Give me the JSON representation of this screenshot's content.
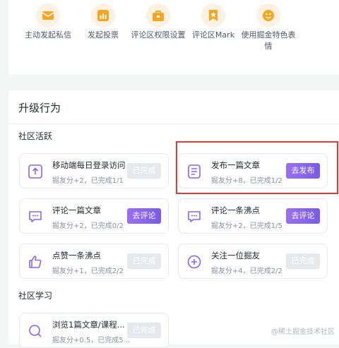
{
  "perks": [
    {
      "label": "主动发起私信",
      "icon": "mail-icon"
    },
    {
      "label": "发起投票",
      "icon": "chart-icon"
    },
    {
      "label": "评论区权限设置",
      "icon": "lock-icon"
    },
    {
      "label": "评论区Mark",
      "icon": "bookmark-star-icon"
    },
    {
      "label": "使用掘金特色表情",
      "icon": "smile-icon"
    }
  ],
  "section_title": "升级行为",
  "groups": [
    {
      "heading": "社区活跃"
    },
    {
      "heading": "社区学习"
    }
  ],
  "tasks": [
    {
      "name": "移动端每日登录访问",
      "desc": "掘友分+2，已完成1/1",
      "button": "已完成",
      "state": "done",
      "icon": "login-icon"
    },
    {
      "name": "发布一篇文章",
      "desc": "掘友分+8，已完成1/2",
      "button": "去发布",
      "state": "go",
      "icon": "article-icon"
    },
    {
      "name": "评论一篇文章",
      "desc": "掘友分+2，已完成0/2",
      "button": "去评论",
      "state": "go",
      "icon": "comment-icon"
    },
    {
      "name": "评论一条沸点",
      "desc": "掘友分+2，已完成1/5",
      "button": "去评论",
      "state": "go",
      "icon": "comment-icon"
    },
    {
      "name": "点赞一条沸点",
      "desc": "掘友分+1，已完成2/2",
      "button": "已完成",
      "state": "done",
      "icon": "thumbs-up-icon"
    },
    {
      "name": "关注一位掘友",
      "desc": "掘友分+4，已完成2/2",
      "button": "已完成",
      "state": "done",
      "icon": "follow-plus-icon"
    },
    {
      "name": "浏览1篇文章/课程...",
      "desc": "掘友分+0.5，已完成5...",
      "button": "已完成",
      "state": "done",
      "icon": "search-icon"
    }
  ],
  "watermark": "@稀土掘金技术社区",
  "colors": {
    "accent": "#8a63ee",
    "perk_bg": "#fdf1e2",
    "perk_fg": "#f5a623",
    "highlight": "#e53935",
    "underline": "#ffc91a"
  }
}
